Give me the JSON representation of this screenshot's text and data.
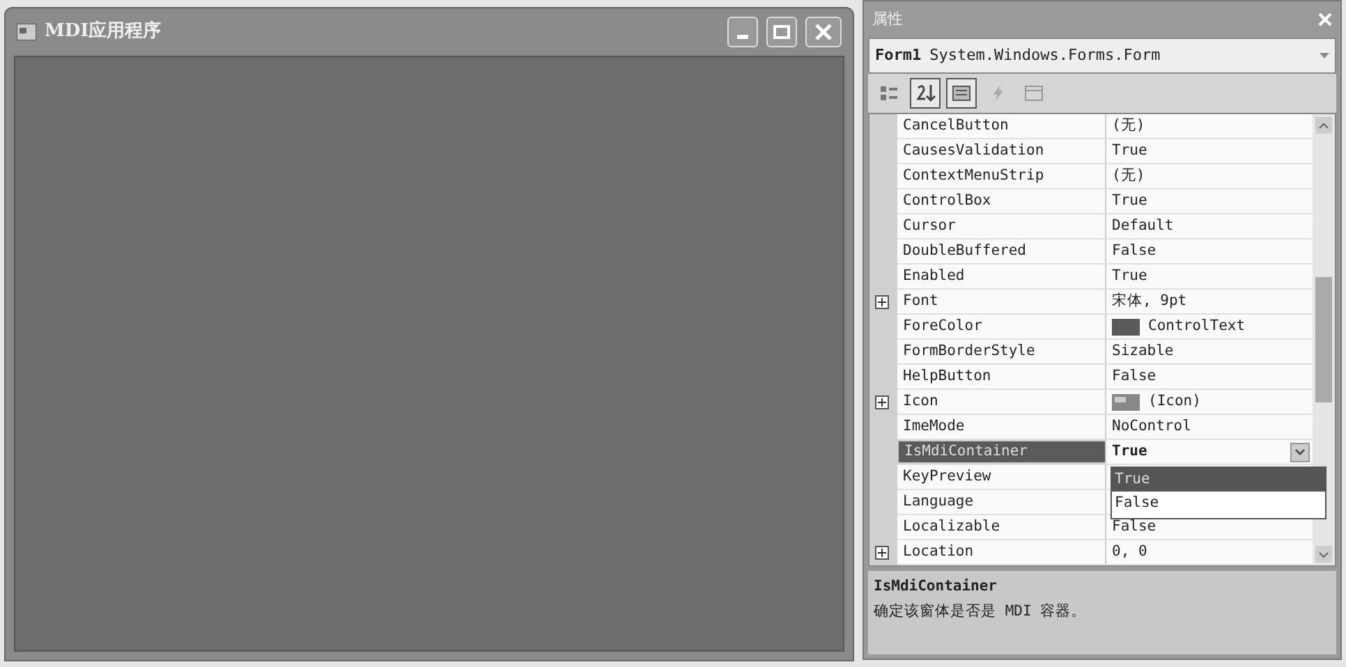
{
  "form_window": {
    "title": "MDI应用程序"
  },
  "properties_panel": {
    "title": "属性",
    "object": {
      "name": "Form1",
      "type": "System.Windows.Forms.Form"
    },
    "toolbar": [
      {
        "kind": "categorized",
        "selected": false
      },
      {
        "kind": "alphabetical",
        "selected": true
      },
      {
        "kind": "properties",
        "selected": true
      },
      {
        "kind": "events",
        "selected": false
      },
      {
        "kind": "pages",
        "selected": false
      }
    ],
    "rows": [
      {
        "name": "CancelButton",
        "value": "(无)",
        "kind": "text",
        "selected": false
      },
      {
        "name": "CausesValidation",
        "value": "True",
        "kind": "text",
        "selected": false
      },
      {
        "name": "ContextMenuStrip",
        "value": "(无)",
        "kind": "text",
        "selected": false
      },
      {
        "name": "ControlBox",
        "value": "True",
        "kind": "text",
        "selected": false
      },
      {
        "name": "Cursor",
        "value": "Default",
        "kind": "text",
        "selected": false
      },
      {
        "name": "DoubleBuffered",
        "value": "False",
        "kind": "text",
        "selected": false
      },
      {
        "name": "Enabled",
        "value": "True",
        "kind": "text",
        "selected": false
      },
      {
        "name": "Font",
        "value": "宋体, 9pt",
        "kind": "text",
        "expandable": true,
        "selected": false
      },
      {
        "name": "ForeColor",
        "value": "ControlText",
        "kind": "color",
        "color": "#5a5a5a",
        "selected": false
      },
      {
        "name": "FormBorderStyle",
        "value": "Sizable",
        "kind": "text",
        "selected": false
      },
      {
        "name": "HelpButton",
        "value": "False",
        "kind": "text",
        "selected": false
      },
      {
        "name": "Icon",
        "value": "(Icon)",
        "kind": "image",
        "expandable": true,
        "selected": false
      },
      {
        "name": "ImeMode",
        "value": "NoControl",
        "kind": "text",
        "selected": false
      },
      {
        "name": "IsMdiContainer",
        "value": "True",
        "kind": "dropdown",
        "selected": true
      },
      {
        "name": "KeyPreview",
        "kind": "text",
        "selected": false
      },
      {
        "name": "Language",
        "kind": "text",
        "selected": false
      },
      {
        "name": "Localizable",
        "value": "False",
        "kind": "text",
        "selected": false
      },
      {
        "name": "Location",
        "value": "0, 0",
        "kind": "text",
        "expandable": true,
        "selected": false
      }
    ],
    "dropdown_options": [
      {
        "label": "True",
        "selected": true
      },
      {
        "label": "False",
        "selected": false
      }
    ],
    "description": {
      "title": "IsMdiContainer",
      "text": "确定该窗体是否是 MDI 容器。"
    }
  }
}
